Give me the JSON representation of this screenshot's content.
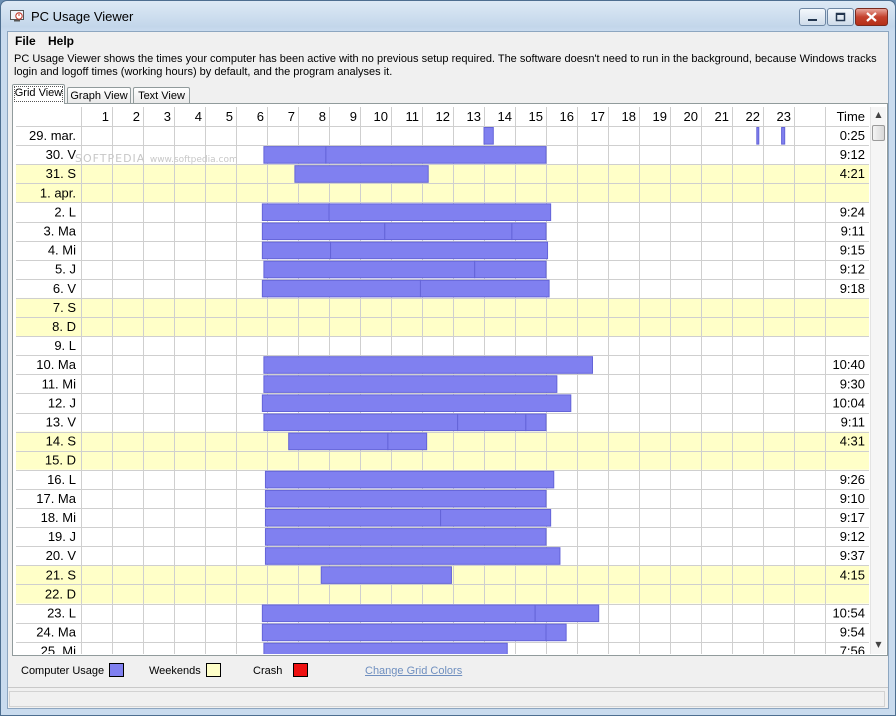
{
  "window": {
    "title": "PC Usage Viewer"
  },
  "menu": [
    "File",
    "Help"
  ],
  "description": "PC Usage Viewer shows the times your computer has been active with no previous setup required. The software doesn't need to run in the background, because Windows tracks login and logoff times (working hours) by default, and the program analyses it.",
  "tabs": [
    "Grid View",
    "Graph View",
    "Text View"
  ],
  "active_tab": 0,
  "watermark": "SOFTPEDIA",
  "watermark_url": "www.softpedia.com",
  "grid": {
    "hours": [
      "1",
      "2",
      "3",
      "4",
      "5",
      "6",
      "7",
      "8",
      "9",
      "10",
      "11",
      "12",
      "13",
      "14",
      "15",
      "16",
      "17",
      "18",
      "19",
      "20",
      "21",
      "22",
      "23"
    ],
    "time_header": "Time",
    "rows": [
      {
        "label": "29. mar.",
        "weekend": false,
        "time": "0:25",
        "sessions": [
          [
            13.0,
            13.3
          ],
          [
            21.8,
            21.8
          ],
          [
            22.6,
            22.7
          ]
        ]
      },
      {
        "label": "30. V",
        "weekend": false,
        "time": "9:12",
        "sessions": [
          [
            5.9,
            7.9
          ],
          [
            7.9,
            15.0
          ]
        ]
      },
      {
        "label": "31. S",
        "weekend": true,
        "time": "4:21",
        "sessions": [
          [
            6.9,
            11.2
          ]
        ]
      },
      {
        "label": "1. apr.",
        "weekend": true,
        "time": "",
        "sessions": []
      },
      {
        "label": "2. L",
        "weekend": false,
        "time": "9:24",
        "sessions": [
          [
            5.85,
            8.0
          ],
          [
            8.0,
            15.15
          ]
        ]
      },
      {
        "label": "3. Ma",
        "weekend": false,
        "time": "9:11",
        "sessions": [
          [
            5.85,
            9.8
          ],
          [
            9.8,
            13.9
          ],
          [
            13.9,
            15.0
          ]
        ]
      },
      {
        "label": "4. Mi",
        "weekend": false,
        "time": "9:15",
        "sessions": [
          [
            5.85,
            8.05
          ],
          [
            8.05,
            15.05
          ]
        ]
      },
      {
        "label": "5. J",
        "weekend": false,
        "time": "9:12",
        "sessions": [
          [
            5.9,
            12.7
          ],
          [
            12.7,
            15.0
          ]
        ]
      },
      {
        "label": "6. V",
        "weekend": false,
        "time": "9:18",
        "sessions": [
          [
            5.85,
            10.95
          ],
          [
            10.95,
            15.1
          ]
        ]
      },
      {
        "label": "7. S",
        "weekend": true,
        "time": "",
        "sessions": []
      },
      {
        "label": "8. D",
        "weekend": true,
        "time": "",
        "sessions": []
      },
      {
        "label": "9. L",
        "weekend": false,
        "time": "",
        "sessions": []
      },
      {
        "label": "10. Ma",
        "weekend": false,
        "time": "10:40",
        "sessions": [
          [
            5.9,
            16.5
          ]
        ]
      },
      {
        "label": "11. Mi",
        "weekend": false,
        "time": "9:30",
        "sessions": [
          [
            5.9,
            15.35
          ]
        ]
      },
      {
        "label": "12. J",
        "weekend": false,
        "time": "10:04",
        "sessions": [
          [
            5.85,
            15.8
          ]
        ]
      },
      {
        "label": "13. V",
        "weekend": false,
        "time": "9:11",
        "sessions": [
          [
            5.9,
            12.15
          ],
          [
            12.15,
            14.35
          ],
          [
            14.35,
            15.0
          ]
        ]
      },
      {
        "label": "14. S",
        "weekend": true,
        "time": "4:31",
        "sessions": [
          [
            6.7,
            9.9
          ],
          [
            9.9,
            11.15
          ]
        ]
      },
      {
        "label": "15. D",
        "weekend": true,
        "time": "",
        "sessions": []
      },
      {
        "label": "16. L",
        "weekend": false,
        "time": "9:26",
        "sessions": [
          [
            5.95,
            15.25
          ]
        ]
      },
      {
        "label": "17. Ma",
        "weekend": false,
        "time": "9:10",
        "sessions": [
          [
            5.95,
            15.0
          ]
        ]
      },
      {
        "label": "18. Mi",
        "weekend": false,
        "time": "9:17",
        "sessions": [
          [
            5.95,
            11.6
          ],
          [
            11.6,
            15.15
          ]
        ]
      },
      {
        "label": "19. J",
        "weekend": false,
        "time": "9:12",
        "sessions": [
          [
            5.95,
            15.0
          ]
        ]
      },
      {
        "label": "20. V",
        "weekend": false,
        "time": "9:37",
        "sessions": [
          [
            5.95,
            15.45
          ]
        ]
      },
      {
        "label": "21. S",
        "weekend": true,
        "time": "4:15",
        "sessions": [
          [
            7.75,
            11.95
          ]
        ]
      },
      {
        "label": "22. D",
        "weekend": true,
        "time": "",
        "sessions": []
      },
      {
        "label": "23. L",
        "weekend": false,
        "time": "10:54",
        "sessions": [
          [
            5.85,
            14.65
          ],
          [
            14.65,
            16.7
          ]
        ]
      },
      {
        "label": "24. Ma",
        "weekend": false,
        "time": "9:54",
        "sessions": [
          [
            5.85,
            15.0
          ],
          [
            15.0,
            15.65
          ]
        ]
      },
      {
        "label": "25. Mi",
        "weekend": false,
        "time": "7:56",
        "sessions": [
          [
            5.9,
            13.75
          ]
        ]
      }
    ]
  },
  "legend": {
    "usage_label": "Computer Usage",
    "weekends_label": "Weekends",
    "crash_label": "Crash",
    "link": "Change Grid Colors"
  },
  "colors": {
    "usage": "#8080f0",
    "usage_border": "#6464d8",
    "weekend": "#ffffc8",
    "crash": "#ee1111",
    "grid_line": "#cfcfcf"
  }
}
